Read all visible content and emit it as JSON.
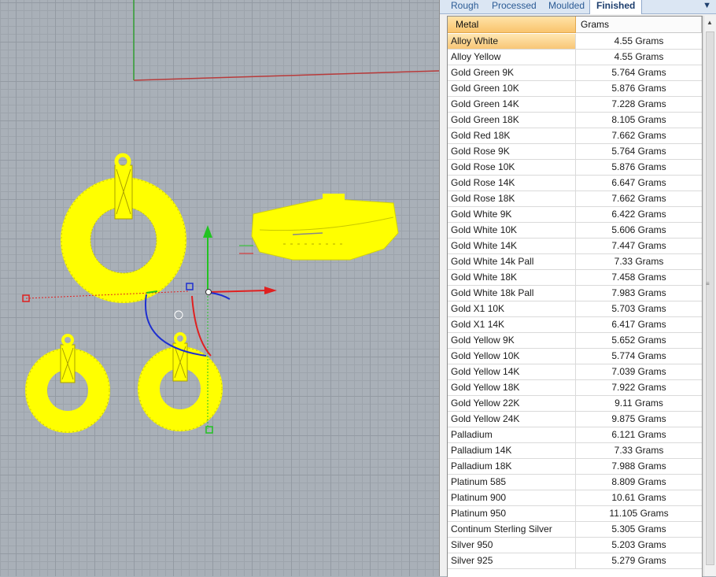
{
  "tabs": [
    {
      "label": "Rough"
    },
    {
      "label": "Processed"
    },
    {
      "label": "Moulded"
    },
    {
      "label": "Finished"
    }
  ],
  "tab_menu_icon": "dropdown-arrow-icon",
  "table": {
    "headers": {
      "metal": "Metal",
      "grams": "Grams"
    },
    "selected_row": 0,
    "rows": [
      {
        "metal": "Alloy White",
        "grams": "4.55 Grams"
      },
      {
        "metal": "Alloy Yellow",
        "grams": "4.55 Grams"
      },
      {
        "metal": "Gold Green 9K",
        "grams": "5.764 Grams"
      },
      {
        "metal": "Gold Green 10K",
        "grams": "5.876 Grams"
      },
      {
        "metal": "Gold Green 14K",
        "grams": "7.228 Grams"
      },
      {
        "metal": "Gold Green 18K",
        "grams": "8.105 Grams"
      },
      {
        "metal": "Gold Red 18K",
        "grams": "7.662 Grams"
      },
      {
        "metal": "Gold Rose 9K",
        "grams": "5.764 Grams"
      },
      {
        "metal": "Gold Rose 10K",
        "grams": "5.876 Grams"
      },
      {
        "metal": "Gold Rose 14K",
        "grams": "6.647 Grams"
      },
      {
        "metal": "Gold Rose 18K",
        "grams": "7.662 Grams"
      },
      {
        "metal": "Gold White 9K",
        "grams": "6.422 Grams"
      },
      {
        "metal": "Gold White 10K",
        "grams": "5.606 Grams"
      },
      {
        "metal": "Gold White 14K",
        "grams": "7.447 Grams"
      },
      {
        "metal": "Gold White 14k Pall",
        "grams": "7.33 Grams"
      },
      {
        "metal": "Gold White 18K",
        "grams": "7.458 Grams"
      },
      {
        "metal": "Gold White 18k Pall",
        "grams": "7.983 Grams"
      },
      {
        "metal": "Gold X1 10K",
        "grams": "5.703 Grams"
      },
      {
        "metal": "Gold X1 14K",
        "grams": "6.417 Grams"
      },
      {
        "metal": "Gold Yellow 9K",
        "grams": "5.652 Grams"
      },
      {
        "metal": "Gold Yellow 10K",
        "grams": "5.774 Grams"
      },
      {
        "metal": "Gold Yellow 14K",
        "grams": "7.039 Grams"
      },
      {
        "metal": "Gold Yellow 18K",
        "grams": "7.922 Grams"
      },
      {
        "metal": "Gold Yellow 22K",
        "grams": "9.11 Grams"
      },
      {
        "metal": "Gold Yellow 24K",
        "grams": "9.875 Grams"
      },
      {
        "metal": "Palladium",
        "grams": "6.121 Grams"
      },
      {
        "metal": "Palladium 14K",
        "grams": "7.33 Grams"
      },
      {
        "metal": "Palladium 18K",
        "grams": "7.988 Grams"
      },
      {
        "metal": "Platinum 585",
        "grams": "8.809 Grams"
      },
      {
        "metal": "Platinum 900",
        "grams": "10.61 Grams"
      },
      {
        "metal": "Platinum 950",
        "grams": "11.105 Grams"
      },
      {
        "metal": "Continum Sterling Silver",
        "grams": "5.305 Grams"
      },
      {
        "metal": "Silver 950",
        "grams": "5.203 Grams"
      },
      {
        "metal": "Silver 925",
        "grams": "5.279 Grams"
      }
    ]
  },
  "colors": {
    "selected_object": "#ffff00",
    "axis_x": "#e02020",
    "axis_y": "#22c322",
    "axis_z": "#1e2fd0",
    "selection_highlight": "#f8c676"
  }
}
